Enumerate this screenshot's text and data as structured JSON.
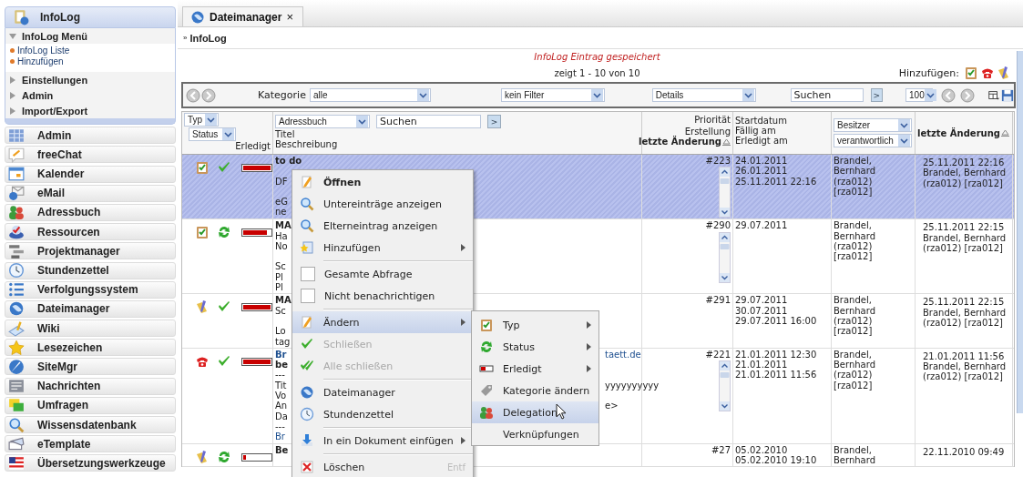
{
  "sidebar": {
    "header": {
      "title": "InfoLog"
    },
    "sections": [
      {
        "title": "InfoLog Menü",
        "expanded": true,
        "links": [
          "InfoLog Liste",
          "Hinzufügen"
        ]
      },
      {
        "title": "Einstellungen",
        "expanded": false
      },
      {
        "title": "Admin",
        "expanded": false
      },
      {
        "title": "Import/Export",
        "expanded": false
      }
    ],
    "apps": [
      {
        "label": "Admin"
      },
      {
        "label": "freeChat"
      },
      {
        "label": "Kalender"
      },
      {
        "label": "eMail"
      },
      {
        "label": "Adressbuch"
      },
      {
        "label": "Ressourcen"
      },
      {
        "label": "Projektmanager"
      },
      {
        "label": "Stundenzettel"
      },
      {
        "label": "Verfolgungssystem"
      },
      {
        "label": "Dateimanager"
      },
      {
        "label": "Wiki"
      },
      {
        "label": "Lesezeichen"
      },
      {
        "label": "SiteMgr"
      },
      {
        "label": "Nachrichten"
      },
      {
        "label": "Umfragen"
      },
      {
        "label": "Wissensdatenbank"
      },
      {
        "label": "eTemplate"
      },
      {
        "label": "Übersetzungswerkzeuge"
      }
    ]
  },
  "tabs": [
    {
      "label": "Dateimanager",
      "close": "×",
      "selected": true
    }
  ],
  "breadcrumb": {
    "mark": "»",
    "label": "InfoLog"
  },
  "message": "InfoLog Eintrag gespeichert",
  "count": "zeigt 1 - 10 von 10",
  "add": {
    "label": "Hinzufügen:"
  },
  "toolbar": {
    "category_label": "Kategorie",
    "category": "alle",
    "filter": "kein Filter",
    "view": "Details",
    "search": "Suchen",
    "go": ">",
    "page_size": "100"
  },
  "header": {
    "type_filter": "Typ",
    "status_filter": "Status",
    "done_label": "Erledigt",
    "addressbook": "Adressbuch",
    "search": "Suchen",
    "go": ">",
    "title_label": "Titel",
    "desc_label": "Beschreibung",
    "prio_lines": [
      "Priorität",
      "Erstellung"
    ],
    "prio_sort": "letzte Änderung",
    "dates": [
      "Startdatum",
      "Fällig am",
      "Erledigt am"
    ],
    "owner": "Besitzer",
    "responsible": "verantwortlich",
    "last_change": "letzte Änderung"
  },
  "rows": [
    {
      "selected": true,
      "kind": "task",
      "done": true,
      "level": 1,
      "desc": [
        {
          "kind": "bold",
          "text": "to do"
        },
        {
          "kind": "blank"
        },
        {
          "kind": "plain",
          "text": "DF"
        },
        {
          "kind": "blank"
        },
        {
          "kind": "plain",
          "text": "eG"
        },
        {
          "kind": "plain",
          "text": "ne"
        }
      ],
      "prio": "#223",
      "scrollable": true,
      "dates": [
        "24.01.2011",
        "26.01.2011",
        "25.11.2011 22:16"
      ],
      "owner": "Brandel, Bernhard (rza012) [rza012]",
      "modified": {
        "date": "25.11.2011 22:16",
        "by": "Brandel, Bernhard (rza012) [rza012]"
      }
    },
    {
      "selected": false,
      "kind": "task",
      "done": false,
      "level": 0.85,
      "desc": [
        {
          "kind": "bold",
          "text": "MA"
        },
        {
          "kind": "plain",
          "text": "Ha"
        },
        {
          "kind": "plain",
          "text": "No"
        },
        {
          "kind": "blank"
        },
        {
          "kind": "plain",
          "text": "Sc"
        },
        {
          "kind": "plain",
          "text": "Pl"
        },
        {
          "kind": "plain",
          "text": "Pl"
        }
      ],
      "prio": "#290",
      "scrollable": true,
      "dates": [
        "29.07.2011"
      ],
      "owner": "Brandel, Bernhard (rza012) [rza012]",
      "modified": {
        "date": "25.11.2011 22:15",
        "by": "Brandel, Bernhard (rza012) [rza012]"
      }
    },
    {
      "selected": false,
      "kind": "note",
      "done": true,
      "level": 1,
      "desc": [
        {
          "kind": "bold",
          "text": "MA"
        },
        {
          "kind": "plain",
          "text": "Sc"
        },
        {
          "kind": "blank"
        },
        {
          "kind": "plain",
          "text": "Lo"
        },
        {
          "kind": "plain",
          "text": "tag"
        }
      ],
      "prio": "#291",
      "scrollable": false,
      "dates": [
        "29.07.2011",
        "30.07.2011",
        "29.07.2011 16:00"
      ],
      "owner": "Brandel, Bernhard (rza012) [rza012]",
      "modified": {
        "date": "25.11.2011 22:15",
        "by": "Brandel, Bernhard (rza012) [rza012]"
      }
    },
    {
      "selected": false,
      "kind": "phone",
      "done": true,
      "level": 1,
      "desc": [
        {
          "kind": "link",
          "text": "Br",
          "tail": {
            "kind": "link",
            "text": "taett.de"
          }
        },
        {
          "kind": "bold",
          "text": "be"
        },
        {
          "kind": "plain",
          "text": "---"
        },
        {
          "kind": "plain",
          "text": "Tit",
          "tail": {
            "kind": "plain",
            "text": "yyyyyyyyyy"
          }
        },
        {
          "kind": "plain",
          "text": "Vo"
        },
        {
          "kind": "plain",
          "text": "An",
          "tail": {
            "kind": "plain",
            "text": "e>"
          }
        },
        {
          "kind": "plain",
          "text": "Da"
        },
        {
          "kind": "plain",
          "text": "---"
        },
        {
          "kind": "link",
          "text": "Br"
        }
      ],
      "prio": "#221",
      "scrollable": true,
      "dates": [
        "21.01.2011 12:30",
        "21.01.2011",
        "21.01.2011 11:56"
      ],
      "owner": "Brandel, Bernhard (rza012) [rza012]",
      "modified": {
        "date": "21.01.2011 11:56",
        "by": "Brandel, Bernhard (rza012) [rza012]"
      }
    },
    {
      "selected": false,
      "kind": "note",
      "done": false,
      "level": 0.1,
      "desc": [
        {
          "kind": "bold",
          "text": "Be"
        }
      ],
      "prio": "#27",
      "dates": [
        "05.02.2010",
        "05.02.2010 19:10"
      ],
      "owner": "Brandel, Bernhard",
      "modified": {
        "date": "22.11.2010 09:49"
      }
    }
  ],
  "context_menu": {
    "items": [
      {
        "kind": "item",
        "label": "Öffnen",
        "bold": true,
        "selected": false
      },
      {
        "kind": "item",
        "label": "Untereinträge anzeigen",
        "selected": false
      },
      {
        "kind": "item",
        "label": "Elterneintrag anzeigen",
        "selected": false
      },
      {
        "kind": "item",
        "label": "Hinzufügen",
        "submenu": true,
        "selected": false
      },
      {
        "kind": "separator"
      },
      {
        "kind": "checkbox",
        "label": "Gesamte Abfrage",
        "checked": false,
        "selected": false
      },
      {
        "kind": "checkbox",
        "label": "Nicht benachrichtigen",
        "checked": false,
        "selected": false
      },
      {
        "kind": "separator"
      },
      {
        "kind": "item",
        "label": "Ändern",
        "submenu": true,
        "selected": true
      },
      {
        "kind": "item",
        "label": "Schließen",
        "disabled": true,
        "selected": false
      },
      {
        "kind": "item",
        "label": "Alle schließen",
        "disabled": true,
        "selected": false
      },
      {
        "kind": "separator"
      },
      {
        "kind": "item",
        "label": "Dateimanager",
        "selected": false
      },
      {
        "kind": "item",
        "label": "Stundenzettel",
        "selected": false
      },
      {
        "kind": "separator"
      },
      {
        "kind": "item",
        "label": "In ein Dokument einfügen",
        "submenu": true,
        "selected": false
      },
      {
        "kind": "separator"
      },
      {
        "kind": "item",
        "label": "Löschen",
        "shortcut": "Entf",
        "selected": false
      }
    ]
  },
  "submenu": {
    "items": [
      {
        "kind": "item",
        "label": "Typ",
        "submenu": true,
        "selected": false
      },
      {
        "kind": "item",
        "label": "Status",
        "submenu": true,
        "selected": false
      },
      {
        "kind": "item",
        "label": "Erledigt",
        "submenu": true,
        "selected": false
      },
      {
        "kind": "item",
        "label": "Kategorie ändern",
        "selected": false
      },
      {
        "kind": "item",
        "label": "Delegation",
        "selected": true
      },
      {
        "kind": "item",
        "label": "Verknüpfungen",
        "selected": false
      }
    ]
  }
}
